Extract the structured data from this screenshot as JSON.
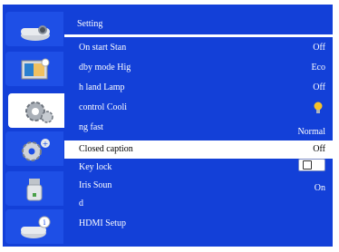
{
  "menu": {
    "title": "Setting",
    "rows": [
      {
        "label": "On start Stan",
        "value": "Off"
      },
      {
        "label": "dby mode  Hig",
        "value": "Eco"
      },
      {
        "label": "h land  Lamp",
        "value": "Off"
      },
      {
        "label": "control  Cooli",
        "value": ""
      },
      {
        "label": "ng fast",
        "value": "Normal"
      },
      {
        "label": "Closed caption",
        "value": "Off"
      },
      {
        "label": "Key lock",
        "value": ""
      },
      {
        "label": "Iris  Soun",
        "value": "On"
      },
      {
        "label": "d",
        "value": ""
      },
      {
        "label": "HDMI Setup",
        "value": ""
      }
    ]
  },
  "sidebar": {
    "items": [
      {
        "icon": "projector-icon"
      },
      {
        "icon": "picture-icon"
      },
      {
        "icon": "settings-gear-icon"
      },
      {
        "icon": "advanced-gears-icon"
      },
      {
        "icon": "usb-drive-icon"
      },
      {
        "icon": "info-icon"
      }
    ]
  },
  "colors": {
    "background": "#1340d8",
    "highlight": "#ffffff",
    "text": "#ffffff"
  }
}
